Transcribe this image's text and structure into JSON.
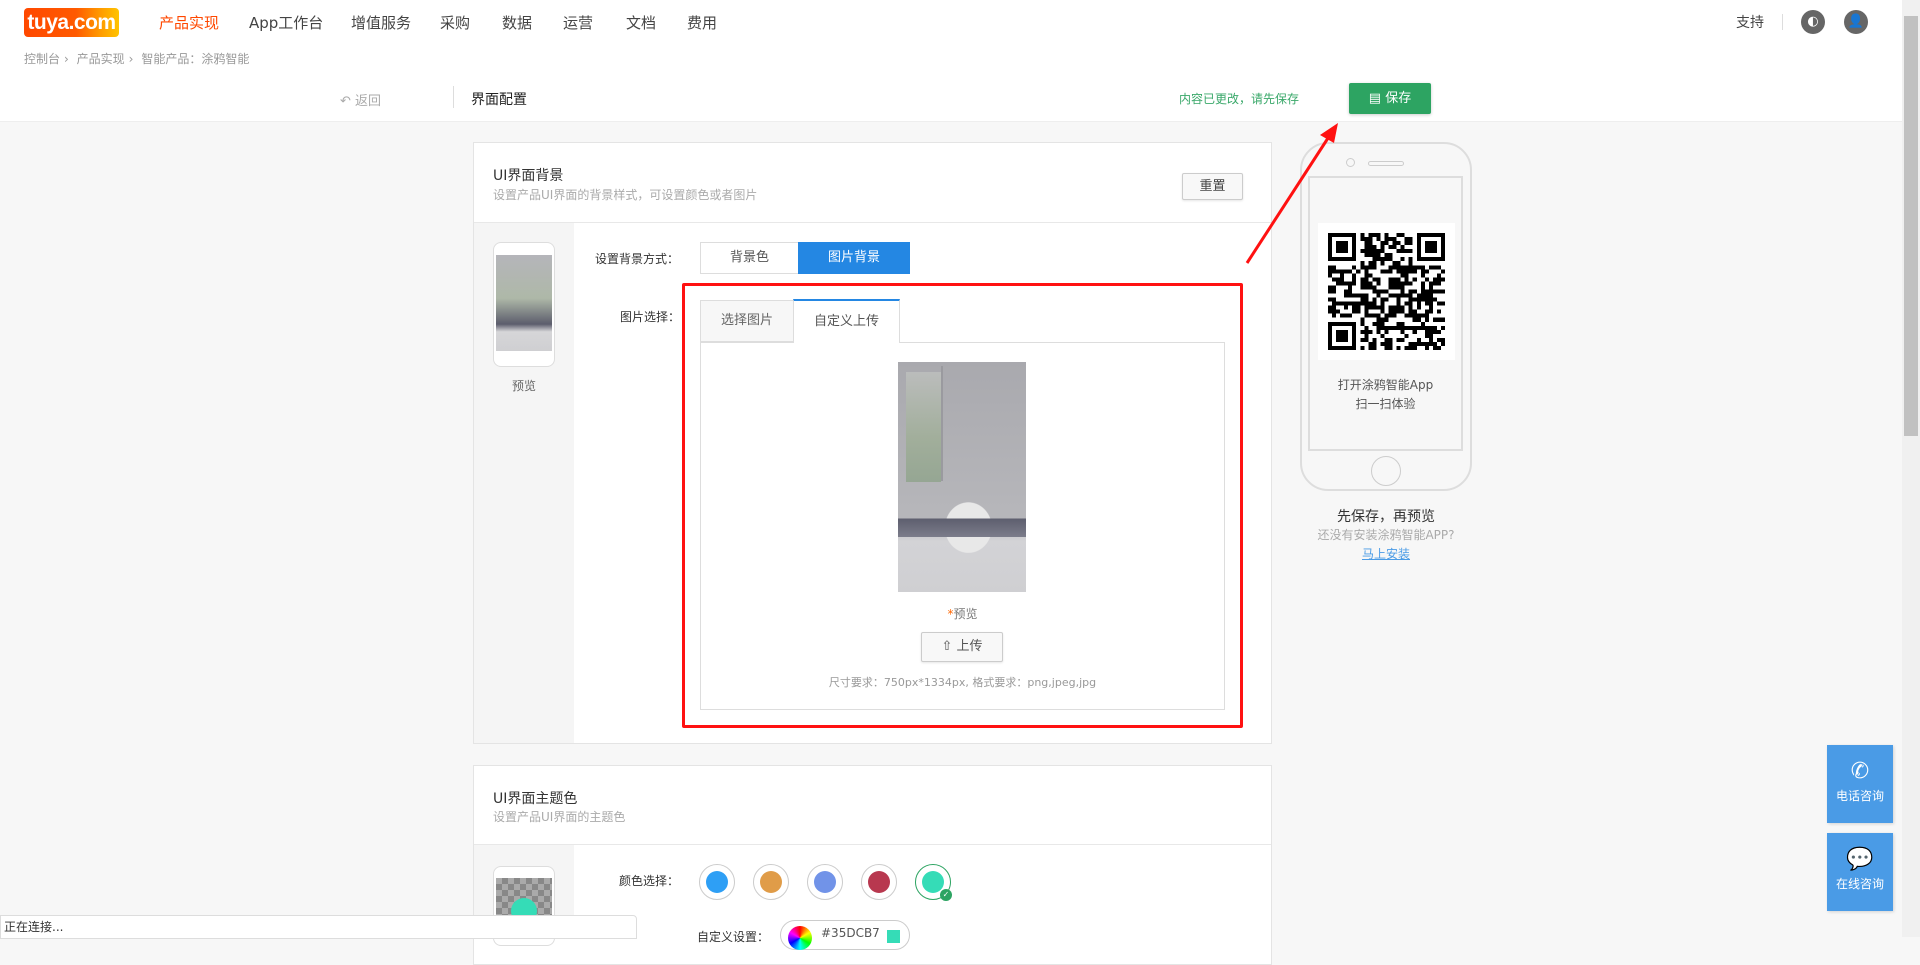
{
  "topnav": {
    "logo": "tuya.com",
    "items": [
      "产品实现",
      "App工作台",
      "增值服务",
      "采购",
      "数据",
      "运营",
      "文档",
      "费用"
    ],
    "active": 0,
    "support": "支持"
  },
  "breadcrumb": [
    "控制台",
    "产品实现",
    "智能产品：涂鸦智能"
  ],
  "subbar": {
    "back": "返回",
    "title": "界面配置",
    "changed_notice": "内容已更改，请先保存",
    "save": "保存"
  },
  "bg_card": {
    "title": "UI界面背景",
    "subtitle": "设置产品UI界面的背景样式，可设置颜色或者图片",
    "reset": "重置",
    "preview_label": "预览",
    "mode_label": "设置背景方式：",
    "modes": [
      "背景色",
      "图片背景"
    ],
    "mode_selected": 1,
    "image_label": "图片选择：",
    "tabs": [
      "选择图片",
      "自定义上传"
    ],
    "tab_selected": 1,
    "preview_star": "*",
    "preview_text": "预览",
    "upload": "上传",
    "hint": "尺寸要求：750px*1334px, 格式要求：png,jpeg,jpg"
  },
  "theme_card": {
    "title": "UI界面主题色",
    "subtitle": "设置产品UI界面的主题色",
    "color_label": "颜色选择：",
    "colors": [
      "#2e9ff5",
      "#e09c48",
      "#7193e8",
      "#b8384f",
      "#35dcb7"
    ],
    "selected": 4,
    "custom_label": "自定义设置：",
    "custom_value": "#35DCB7"
  },
  "phone_preview": {
    "line1": "打开涂鸦智能App",
    "line2": "扫一扫体验",
    "save_first": "先保存，再预览",
    "no_app": "还没有安装涂鸦智能APP?",
    "install": "马上安装"
  },
  "floats": [
    "电话咨询",
    "在线咨询"
  ],
  "status": "正在连接...",
  "colors": {
    "accent": "#2487e3",
    "save": "#2da462",
    "nav_active": "#ff4800",
    "annotation": "#ff1111"
  }
}
